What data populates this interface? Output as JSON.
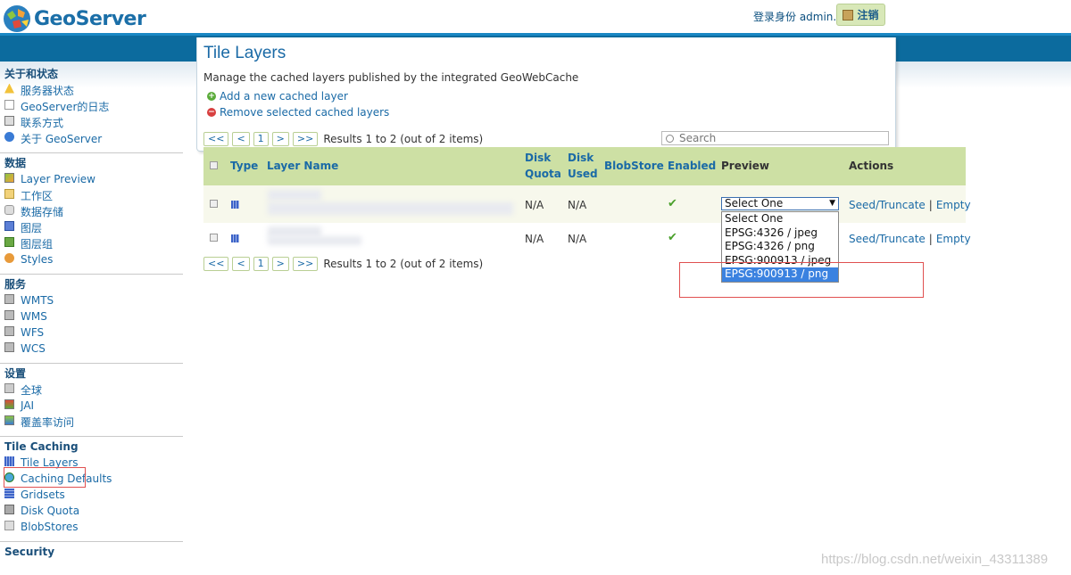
{
  "header": {
    "logo_text": "GeoServer",
    "login_info": "登录身份 admin.",
    "logout_label": "注销"
  },
  "sidebar": {
    "sections": [
      {
        "title": "关于和状态",
        "items": [
          {
            "label": "服务器状态",
            "icon": "warning-icon"
          },
          {
            "label": "GeoServer的日志",
            "icon": "document-icon"
          },
          {
            "label": "联系方式",
            "icon": "contact-card-icon"
          },
          {
            "label": "关于 GeoServer",
            "icon": "info-icon"
          }
        ]
      },
      {
        "title": "数据",
        "items": [
          {
            "label": "Layer Preview",
            "icon": "map-preview-icon"
          },
          {
            "label": "工作区",
            "icon": "folder-icon"
          },
          {
            "label": "数据存储",
            "icon": "database-icon"
          },
          {
            "label": "图层",
            "icon": "layer-icon"
          },
          {
            "label": "图层组",
            "icon": "layer-group-icon"
          },
          {
            "label": "Styles",
            "icon": "palette-icon"
          }
        ]
      },
      {
        "title": "服务",
        "items": [
          {
            "label": "WMTS",
            "icon": "service-icon"
          },
          {
            "label": "WMS",
            "icon": "service-icon"
          },
          {
            "label": "WFS",
            "icon": "service-icon"
          },
          {
            "label": "WCS",
            "icon": "service-icon"
          }
        ]
      },
      {
        "title": "设置",
        "items": [
          {
            "label": "全球",
            "icon": "server-icon"
          },
          {
            "label": "JAI",
            "icon": "jai-icon"
          },
          {
            "label": "覆盖率访问",
            "icon": "coverage-icon"
          }
        ]
      },
      {
        "title": "Tile Caching",
        "items": [
          {
            "label": "Tile Layers",
            "icon": "tile-layers-icon"
          },
          {
            "label": "Caching Defaults",
            "icon": "globe-icon"
          },
          {
            "label": "Gridsets",
            "icon": "grid-icon"
          },
          {
            "label": "Disk Quota",
            "icon": "disk-icon"
          },
          {
            "label": "BlobStores",
            "icon": "blobstore-icon"
          }
        ]
      },
      {
        "title": "Security",
        "items": []
      }
    ]
  },
  "main": {
    "title": "Tile Layers",
    "description": "Manage the cached layers published by the integrated GeoWebCache",
    "add_link": "Add a new cached layer",
    "remove_link": "Remove selected cached layers",
    "pager": {
      "first": "<<",
      "prev": "<",
      "page": "1",
      "next": ">",
      "last": ">>",
      "info": "Results 1 to 2 (out of 2 items)"
    },
    "search_placeholder": "Search"
  },
  "table": {
    "headers": {
      "type": "Type",
      "layer_name": "Layer Name",
      "disk_quota_1": "Disk",
      "disk_quota_2": "Quota",
      "disk_used_1": "Disk",
      "disk_used_2": "Used",
      "blobstore": "BlobStore",
      "enabled": "Enabled",
      "preview": "Preview",
      "actions": "Actions"
    },
    "rows": [
      {
        "disk_quota": "N/A",
        "disk_used": "N/A",
        "enabled": "✔",
        "seed": "Seed/Truncate",
        "sep": "|",
        "empty": "Empty"
      },
      {
        "disk_quota": "N/A",
        "disk_used": "N/A",
        "enabled": "✔",
        "seed": "Seed/Truncate",
        "sep": "|",
        "empty": "Empty"
      }
    ]
  },
  "preview_select": {
    "selected": "Select One",
    "options": [
      "Select One",
      "EPSG:4326 / jpeg",
      "EPSG:4326 / png",
      "EPSG:900913 / jpeg",
      "EPSG:900913 / png"
    ],
    "highlighted_index": 4
  },
  "watermark": "https://blog.csdn.net/weixin_43311389",
  "colors": {
    "brand_blue": "#0c6b9e",
    "link_blue": "#1a6aa6",
    "table_header": "#cde0a4",
    "highlight_red": "#e05050",
    "dropdown_selected": "#3b82e0"
  }
}
